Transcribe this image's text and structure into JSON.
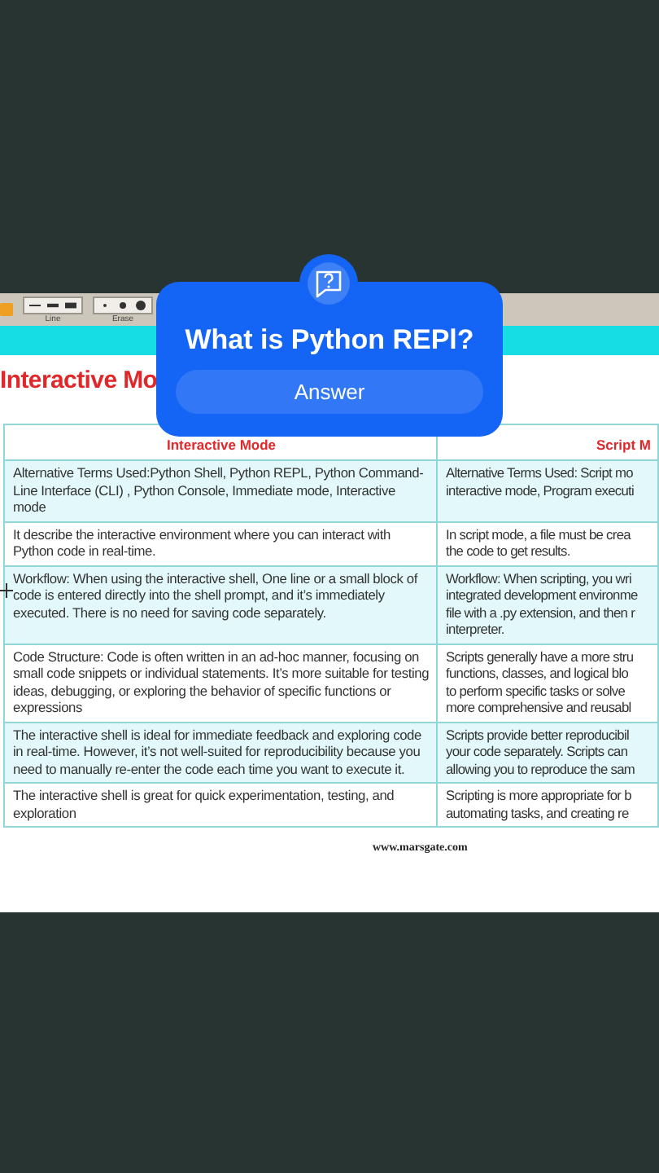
{
  "toolbar": {
    "labels": [
      "Line",
      "Erase"
    ]
  },
  "document": {
    "title": "Interactive Mo",
    "columns": [
      "Interactive Mode",
      "Script M"
    ],
    "rows": [
      {
        "highlighted": true,
        "cells": [
          {
            "text": "Alternative Terms Used:Python Shell, Python REPL, Python Command-Line Interface (CLI) , Python Console, Immediate mode, Interactive mode"
          },
          {
            "lines": [
              "Alternative Terms Used: Script mo",
              "interactive mode, Program executi"
            ]
          }
        ]
      },
      {
        "highlighted": false,
        "cells": [
          {
            "text": "It describe the interactive environment where you can interact with Python code in real-time."
          },
          {
            "lines": [
              "In script mode, a file must be crea",
              "the code to get results."
            ]
          }
        ]
      },
      {
        "highlighted": true,
        "cells": [
          {
            "text": "Workflow: When using the interactive shell, One line or a small block of code is entered directly into the shell prompt, and it’s immediately executed. There is no need for saving code separately."
          },
          {
            "lines": [
              "Workflow: When scripting, you wri",
              "integrated development environme",
              "file with a .py extension, and then r",
              "interpreter."
            ]
          }
        ]
      },
      {
        "highlighted": false,
        "cells": [
          {
            "text": "Code Structure: Code is often written in an ad-hoc manner, focusing on small code snippets or individual statements. It’s more suitable for testing ideas, debugging, or exploring the behavior of specific functions or expressions"
          },
          {
            "lines": [
              "Scripts generally have a more stru",
              "functions, classes, and logical blo",
              "to perform specific tasks or solve",
              "more comprehensive and reusabl"
            ]
          }
        ]
      },
      {
        "highlighted": true,
        "cells": [
          {
            "text": "The interactive shell is ideal for immediate feedback and exploring code in real-time. However, it’s not well-suited for reproducibility because you need to manually re-enter the code each time you want to execute it."
          },
          {
            "lines": [
              "Scripts provide better reproducibil",
              "your code separately. Scripts can",
              "allowing you to reproduce the sam"
            ]
          }
        ]
      },
      {
        "highlighted": false,
        "cells": [
          {
            "text": "The interactive shell is great for quick experimentation, testing, and exploration"
          },
          {
            "lines": [
              "Scripting is more appropriate for b",
              "automating tasks, and creating re"
            ]
          }
        ]
      }
    ],
    "footer": "www.marsgate.com"
  },
  "question_card": {
    "question": "What is Python REPl?",
    "button": "Answer"
  }
}
